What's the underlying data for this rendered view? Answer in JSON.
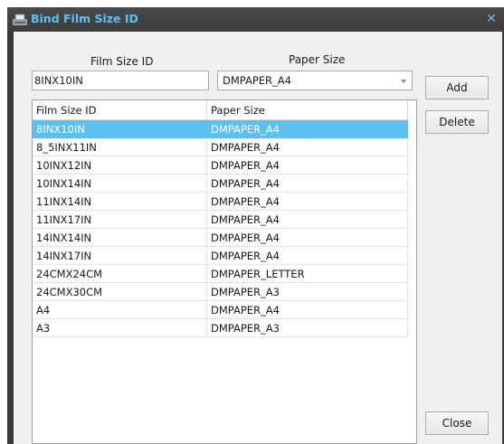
{
  "window": {
    "title": "Bind Film Size ID",
    "close_glyph": "✕",
    "title_icon": "film-printer-icon",
    "accent_color": "#5cc0f5"
  },
  "form": {
    "film_size_label": "Film Size ID",
    "paper_size_label": "Paper Size",
    "film_size_value": "8INX10IN",
    "paper_size_value": "DMPAPER_A4"
  },
  "buttons": {
    "add": "Add",
    "delete": "Delete",
    "close": "Close"
  },
  "grid": {
    "columns": [
      "Film Size ID",
      "Paper Size"
    ],
    "selected_color": "#5cbff2",
    "rows": [
      {
        "film": "8INX10IN",
        "paper": "DMPAPER_A4",
        "selected": true
      },
      {
        "film": "8_5INX11IN",
        "paper": "DMPAPER_A4",
        "selected": false
      },
      {
        "film": "10INX12IN",
        "paper": "DMPAPER_A4",
        "selected": false
      },
      {
        "film": "10INX14IN",
        "paper": "DMPAPER_A4",
        "selected": false
      },
      {
        "film": "11INX14IN",
        "paper": "DMPAPER_A4",
        "selected": false
      },
      {
        "film": "11INX17IN",
        "paper": "DMPAPER_A4",
        "selected": false
      },
      {
        "film": "14INX14IN",
        "paper": "DMPAPER_A4",
        "selected": false
      },
      {
        "film": "14INX17IN",
        "paper": "DMPAPER_A4",
        "selected": false
      },
      {
        "film": "24CMX24CM",
        "paper": "DMPAPER_LETTER",
        "selected": false
      },
      {
        "film": "24CMX30CM",
        "paper": "DMPAPER_A3",
        "selected": false
      },
      {
        "film": "A4",
        "paper": "DMPAPER_A4",
        "selected": false
      },
      {
        "film": "A3",
        "paper": "DMPAPER_A3",
        "selected": false
      }
    ]
  }
}
